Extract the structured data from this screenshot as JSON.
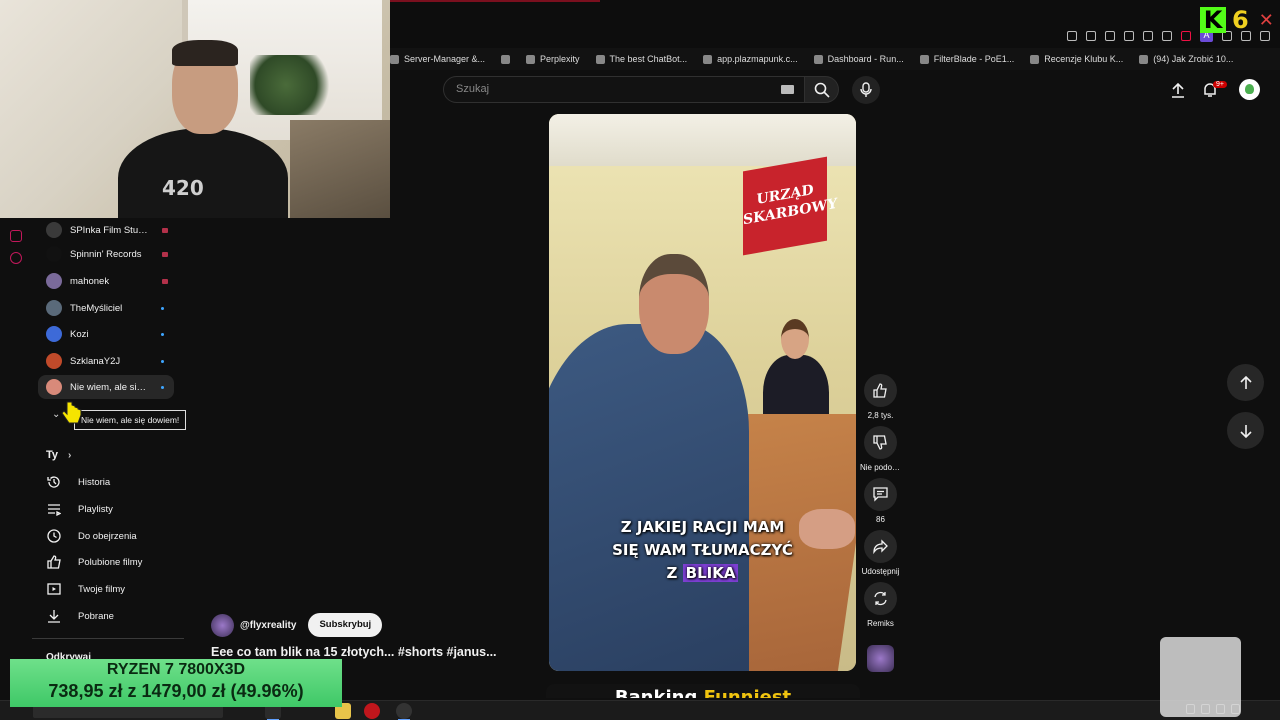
{
  "overlay": {
    "k6": {
      "letter": "K",
      "number": "6",
      "close": "✕"
    },
    "webcam_shirt_text": "420",
    "price": {
      "line1": "RYZEN 7 7800X3D",
      "line2": "738,95 zł z 1479,00 zł (49.96%)",
      "fraction_shown": 0.4996
    }
  },
  "bookmarks": [
    {
      "label": "Server-Manager &...",
      "icon": "server-icon"
    },
    {
      "label": "",
      "icon": "maps-pin-icon"
    },
    {
      "label": "Perplexity",
      "icon": "perplexity-icon"
    },
    {
      "label": "The best ChatBot...",
      "icon": "chatgpt-icon"
    },
    {
      "label": "app.plazmapunk.c...",
      "icon": "page-icon"
    },
    {
      "label": "Dashboard - Run...",
      "icon": "page-icon"
    },
    {
      "label": "FilterBlade - PoE1...",
      "icon": "filterblade-icon"
    },
    {
      "label": "Recenzje Klubu K...",
      "icon": "page-icon"
    },
    {
      "label": "(94) Jak Zrobić 10...",
      "icon": "page-icon"
    }
  ],
  "header": {
    "search_placeholder": "Szukaj",
    "notifications_badge": "9+"
  },
  "subscriptions": [
    {
      "name": "SPInka Film Stud...",
      "indicator": "live",
      "avatar": "#3a3a3a"
    },
    {
      "name": "Spinnin' Records",
      "indicator": "live",
      "avatar": "#111111"
    },
    {
      "name": "mahonek",
      "indicator": "live",
      "avatar": "#7a6a9a"
    },
    {
      "name": "TheMyśliciel",
      "indicator": "new",
      "avatar": "#5a6a7a"
    },
    {
      "name": "Kozi",
      "indicator": "new",
      "avatar": "#3d6ad8"
    },
    {
      "name": "SzklanaY2J",
      "indicator": "new",
      "avatar": "#c04a2a"
    },
    {
      "name": "Nie wiem, ale się...",
      "indicator": "new",
      "avatar": "#d88a7a"
    }
  ],
  "tooltip": "Nie wiem, ale się dowiem!",
  "you_section": {
    "heading": "Ty",
    "items": [
      {
        "label": "Historia",
        "icon": "history-icon"
      },
      {
        "label": "Playlisty",
        "icon": "playlist-icon"
      },
      {
        "label": "Do obejrzenia",
        "icon": "watch-later-icon"
      },
      {
        "label": "Polubione filmy",
        "icon": "like-icon"
      },
      {
        "label": "Twoje filmy",
        "icon": "your-videos-icon"
      },
      {
        "label": "Pobrane",
        "icon": "download-icon"
      }
    ]
  },
  "explore_heading": "Odkrywaj",
  "video": {
    "sign_text": "URZĄD SKARBOWY",
    "caption_lines": [
      "Z JAKIEJ RACJI MAM",
      "SIĘ WAM TŁUMACZYĆ"
    ],
    "caption_prefix": "Z",
    "caption_highlight": "BLIKA",
    "channel": "@flyxreality",
    "subscribe_label": "Subskrybuj",
    "title": "Eee co tam blik na 15 złotych... #shorts  #janus..."
  },
  "actions": {
    "like_count": "2,8 tys.",
    "dislike_label": "Nie podob...",
    "comments_count": "86",
    "share_label": "Udostępnij",
    "remix_label": "Remiks"
  },
  "next_short": {
    "word1": "Banking",
    "word2": "Funniest"
  },
  "colors": {
    "youtube_bg": "#0f0f0f",
    "accent_red": "#cc0000",
    "kick_green": "#53fc18",
    "price_green": "#4fd574",
    "highlight_purple": "#7c3fd1"
  }
}
